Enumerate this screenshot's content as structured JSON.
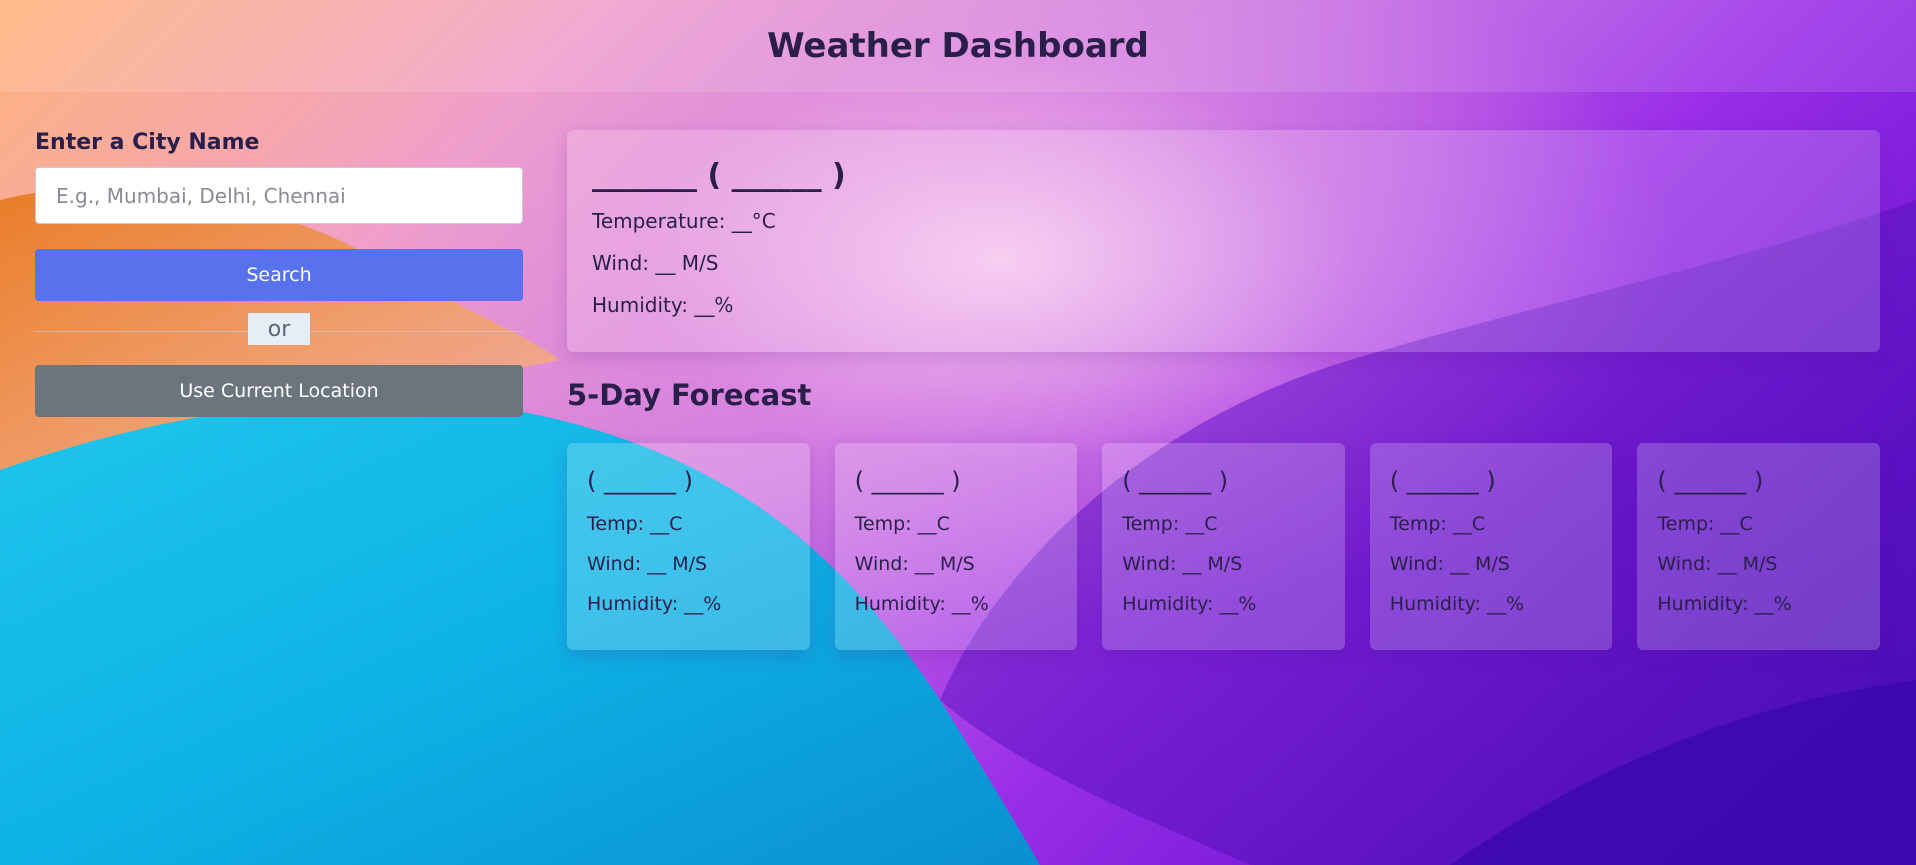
{
  "header": {
    "title": "Weather Dashboard"
  },
  "search": {
    "label": "Enter a City Name",
    "placeholder": "E.g., Mumbai, Delhi, Chennai",
    "value": "",
    "search_button": "Search",
    "separator": "or",
    "location_button": "Use Current Location"
  },
  "current": {
    "title": "_______ ( ______ )",
    "temperature": "Temperature: __°C",
    "wind": "Wind: __ M/S",
    "humidity": "Humidity: __%"
  },
  "forecast": {
    "title": "5-Day Forecast",
    "days": [
      {
        "date": "( ______ )",
        "temp": "Temp: __C",
        "wind": "Wind: __ M/S",
        "humidity": "Humidity: __%"
      },
      {
        "date": "( ______ )",
        "temp": "Temp: __C",
        "wind": "Wind: __ M/S",
        "humidity": "Humidity: __%"
      },
      {
        "date": "( ______ )",
        "temp": "Temp: __C",
        "wind": "Wind: __ M/S",
        "humidity": "Humidity: __%"
      },
      {
        "date": "( ______ )",
        "temp": "Temp: __C",
        "wind": "Wind: __ M/S",
        "humidity": "Humidity: __%"
      },
      {
        "date": "( ______ )",
        "temp": "Temp: __C",
        "wind": "Wind: __ M/S",
        "humidity": "Humidity: __%"
      }
    ]
  },
  "colors": {
    "search_button": "#5872ee",
    "location_button": "#6c757d",
    "text": "#2a1f4a"
  }
}
